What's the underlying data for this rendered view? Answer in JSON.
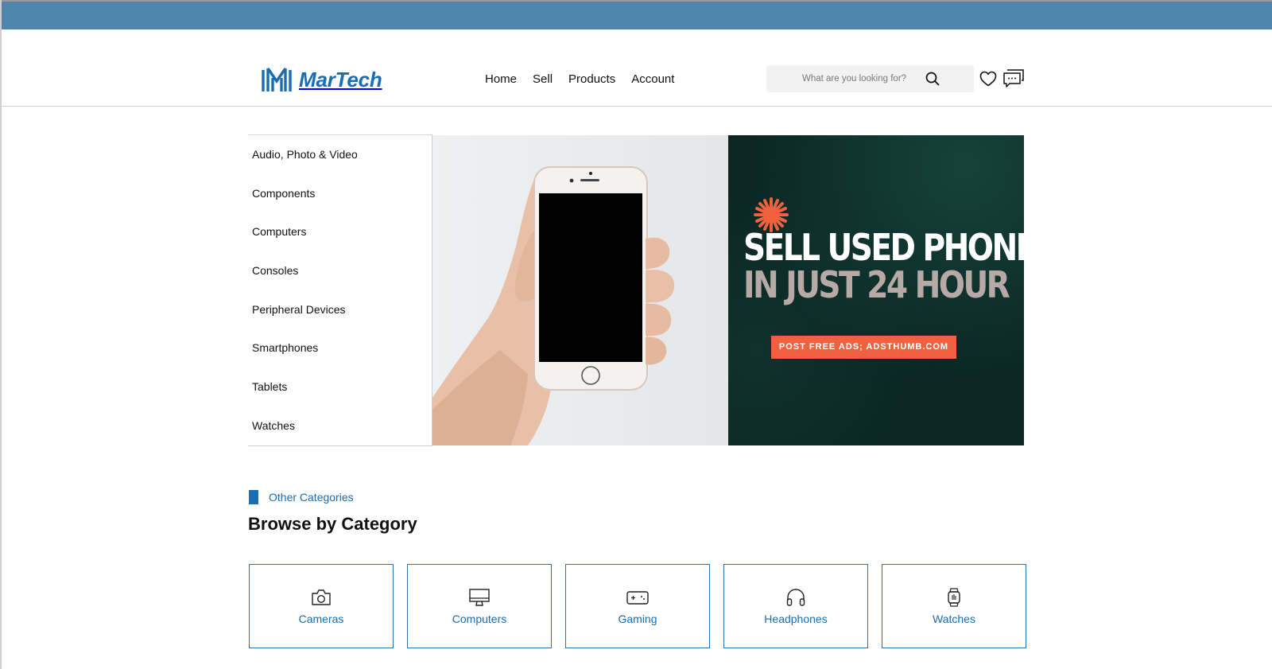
{
  "colors": {
    "topbar": "#4f86ac",
    "brand_blue": "#1a6db0",
    "banner_dark": "#0b2623",
    "banner_cta": "#f0623f",
    "banner_secondary_text": "#b7aaa6"
  },
  "header": {
    "logo_icon": "martech-logo-icon",
    "logo_text": "MarTech",
    "nav": [
      {
        "label": "Home"
      },
      {
        "label": "Sell"
      },
      {
        "label": "Products"
      },
      {
        "label": "Account"
      }
    ],
    "search": {
      "placeholder": "What are you looking for?",
      "icon": "search-icon"
    },
    "wishlist_icon": "heart-icon",
    "messages_icon": "chat-icon"
  },
  "sidebar": {
    "categories": [
      {
        "label": "Audio, Photo & Video"
      },
      {
        "label": "Components"
      },
      {
        "label": "Computers"
      },
      {
        "label": "Consoles"
      },
      {
        "label": "Peripheral Devices"
      },
      {
        "label": "Smartphones"
      },
      {
        "label": "Tablets"
      },
      {
        "label": "Watches"
      }
    ]
  },
  "banner": {
    "line1": "SELL USED PHONE",
    "line2": "IN JUST 24 HOUR",
    "cta": "POST FREE ADS; ADSTHUMB.COM",
    "star_icon": "star-burst-icon",
    "photo": "hand-holding-phone-image"
  },
  "browse": {
    "tag": "Other Categories",
    "title": "Browse by Category",
    "cards": [
      {
        "label": "Cameras",
        "icon": "camera-icon"
      },
      {
        "label": "Computers",
        "icon": "monitor-icon"
      },
      {
        "label": "Gaming",
        "icon": "gamepad-icon"
      },
      {
        "label": "Headphones",
        "icon": "headphones-icon"
      },
      {
        "label": "Watches",
        "icon": "watch-icon"
      }
    ]
  }
}
